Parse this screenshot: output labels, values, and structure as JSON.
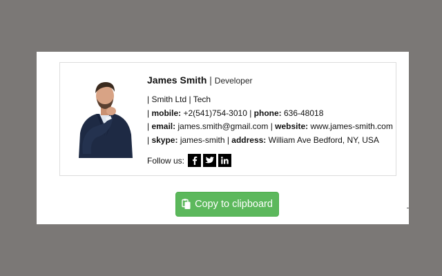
{
  "signature": {
    "name": "James Smith",
    "separator": " | ",
    "job_title": "Developer",
    "company_line": "| Smith Ltd | Tech",
    "mobile_prefix": "| ",
    "mobile_label": "mobile:",
    "mobile_value": " +2(541)754-3010 ",
    "phone_sep": "| ",
    "phone_label": "phone:",
    "phone_value": " 636-48018",
    "email_prefix": "| ",
    "email_label": "email:",
    "email_value": " james.smith@gmail.com ",
    "website_sep": "| ",
    "website_label": "website:",
    "website_value": " www.james-smith.com",
    "skype_prefix": "| ",
    "skype_label": "skype:",
    "skype_value": " james-smith ",
    "address_sep": "| ",
    "address_label": "address:",
    "address_value": " William Ave Bedford, NY, USA",
    "follow_label": "Follow us:",
    "social_icons": [
      "facebook-icon",
      "twitter-icon",
      "linkedin-icon"
    ]
  },
  "copy_button": {
    "label": "Copy to clipboard",
    "icon": "clipboard-icon",
    "color": "#5cb85c"
  },
  "colors": {
    "backdrop": "#7b7876",
    "panel": "#ffffff",
    "social_bg": "#000000"
  }
}
